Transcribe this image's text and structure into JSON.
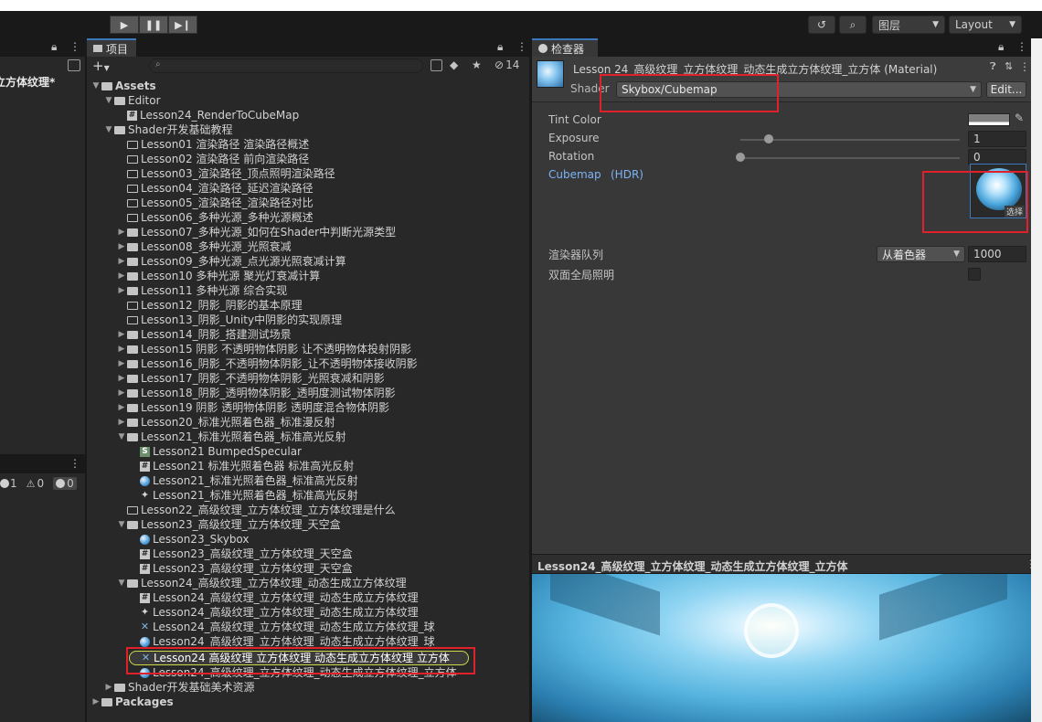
{
  "toolbar": {
    "play_icon": "play-icon",
    "pause_icon": "pause-icon",
    "step_icon": "step-icon",
    "layers_label": "图层",
    "layout_label": "Layout"
  },
  "left_panel": {
    "selected_item": "立方体纹理*",
    "console_counts": {
      "info": "1",
      "warn": "0",
      "error": "0"
    }
  },
  "project": {
    "tab_label": "项目",
    "hidden_count": "14",
    "tree": [
      {
        "depth": 0,
        "arrow": "▼",
        "icon": "folder-open",
        "label": "Assets",
        "bold": true
      },
      {
        "depth": 1,
        "arrow": "▼",
        "icon": "folder-open",
        "label": "Editor"
      },
      {
        "depth": 2,
        "arrow": "",
        "icon": "cs",
        "label": "Lesson24_RenderToCubeMap"
      },
      {
        "depth": 1,
        "arrow": "▼",
        "icon": "folder-open",
        "label": "Shader开发基础教程"
      },
      {
        "depth": 2,
        "arrow": "",
        "icon": "folder-empty",
        "label": "Lesson01 渲染路径 渲染路径概述"
      },
      {
        "depth": 2,
        "arrow": "",
        "icon": "folder-empty",
        "label": "Lesson02 渲染路径 前向渲染路径"
      },
      {
        "depth": 2,
        "arrow": "",
        "icon": "folder-empty",
        "label": "Lesson03_渲染路径_顶点照明渲染路径"
      },
      {
        "depth": 2,
        "arrow": "",
        "icon": "folder-empty",
        "label": "Lesson04_渲染路径_延迟渲染路径"
      },
      {
        "depth": 2,
        "arrow": "",
        "icon": "folder-empty",
        "label": "Lesson05_渲染路径_渲染路径对比"
      },
      {
        "depth": 2,
        "arrow": "",
        "icon": "folder-empty",
        "label": "Lesson06_多种光源_多种光源概述"
      },
      {
        "depth": 2,
        "arrow": "▶",
        "icon": "folder",
        "label": "Lesson07_多种光源_如何在Shader中判断光源类型"
      },
      {
        "depth": 2,
        "arrow": "▶",
        "icon": "folder",
        "label": "Lesson08_多种光源_光照衰减"
      },
      {
        "depth": 2,
        "arrow": "▶",
        "icon": "folder",
        "label": "Lesson09_多种光源_点光源光照衰减计算"
      },
      {
        "depth": 2,
        "arrow": "▶",
        "icon": "folder",
        "label": "Lesson10 多种光源 聚光灯衰减计算"
      },
      {
        "depth": 2,
        "arrow": "▶",
        "icon": "folder",
        "label": "Lesson11 多种光源 综合实现"
      },
      {
        "depth": 2,
        "arrow": "",
        "icon": "folder-empty",
        "label": "Lesson12_阴影_阴影的基本原理"
      },
      {
        "depth": 2,
        "arrow": "",
        "icon": "folder-empty",
        "label": "Lesson13_阴影_Unity中阴影的实现原理"
      },
      {
        "depth": 2,
        "arrow": "▶",
        "icon": "folder",
        "label": "Lesson14_阴影_搭建测试场景"
      },
      {
        "depth": 2,
        "arrow": "▶",
        "icon": "folder",
        "label": "Lesson15 阴影 不透明物体阴影 让不透明物体投射阴影"
      },
      {
        "depth": 2,
        "arrow": "▶",
        "icon": "folder",
        "label": "Lesson16_阴影_不透明物体阴影_让不透明物体接收阴影"
      },
      {
        "depth": 2,
        "arrow": "▶",
        "icon": "folder",
        "label": "Lesson17_阴影_不透明物体阴影_光照衰减和阴影"
      },
      {
        "depth": 2,
        "arrow": "▶",
        "icon": "folder",
        "label": "Lesson18_阴影_透明物体阴影_透明度测试物体阴影"
      },
      {
        "depth": 2,
        "arrow": "▶",
        "icon": "folder",
        "label": "Lesson19 阴影 透明物体阴影 透明度混合物体阴影"
      },
      {
        "depth": 2,
        "arrow": "▶",
        "icon": "folder",
        "label": "Lesson20_标准光照着色器_标准漫反射"
      },
      {
        "depth": 2,
        "arrow": "▼",
        "icon": "folder-open",
        "label": "Lesson21_标准光照着色器_标准高光反射"
      },
      {
        "depth": 3,
        "arrow": "",
        "icon": "shader",
        "label": "Lesson21 BumpedSpecular"
      },
      {
        "depth": 3,
        "arrow": "",
        "icon": "cs",
        "label": "Lesson21 标准光照着色器 标准高光反射"
      },
      {
        "depth": 3,
        "arrow": "",
        "icon": "material",
        "label": "Lesson21_标准光照着色器_标准高光反射"
      },
      {
        "depth": 3,
        "arrow": "",
        "icon": "prefab",
        "label": "Lesson21_标准光照着色器_标准高光反射"
      },
      {
        "depth": 2,
        "arrow": "",
        "icon": "folder-empty",
        "label": "Lesson22_高级纹理_立方体纹理_立方体纹理是什么"
      },
      {
        "depth": 2,
        "arrow": "▼",
        "icon": "folder-open",
        "label": "Lesson23_高级纹理_立方体纹理_天空盒"
      },
      {
        "depth": 3,
        "arrow": "",
        "icon": "material",
        "label": "Lesson23_Skybox"
      },
      {
        "depth": 3,
        "arrow": "",
        "icon": "cs",
        "label": "Lesson23_高级纹理_立方体纹理_天空盒"
      },
      {
        "depth": 3,
        "arrow": "",
        "icon": "cs",
        "label": "Lesson23_高级纹理_立方体纹理_天空盒"
      },
      {
        "depth": 2,
        "arrow": "▼",
        "icon": "folder-open",
        "label": "Lesson24_高级纹理_立方体纹理_动态生成立方体纹理"
      },
      {
        "depth": 3,
        "arrow": "",
        "icon": "cs",
        "label": "Lesson24_高级纹理_立方体纹理_动态生成立方体纹理"
      },
      {
        "depth": 3,
        "arrow": "",
        "icon": "prefab",
        "label": "Lesson24_高级纹理_立方体纹理_动态生成立方体纹理"
      },
      {
        "depth": 3,
        "arrow": "",
        "icon": "rtex",
        "label": "Lesson24_高级纹理_立方体纹理_动态生成立方体纹理_球"
      },
      {
        "depth": 3,
        "arrow": "",
        "icon": "material",
        "label": "Lesson24_高级纹理_立方体纹理_动态生成立方体纹理_球"
      },
      {
        "depth": 3,
        "arrow": "",
        "icon": "rtex",
        "label": "Lesson24 高级纹理 立方体纹理 动态生成立方体纹理 立方体",
        "selected": true
      },
      {
        "depth": 3,
        "arrow": "",
        "icon": "material",
        "label": "Lesson24_高级纹理_立方体纹理_动态生成立方体纹理_立方体"
      },
      {
        "depth": 1,
        "arrow": "▶",
        "icon": "folder",
        "label": "Shader开发基础美术资源"
      },
      {
        "depth": 0,
        "arrow": "▶",
        "icon": "folder",
        "label": "Packages",
        "bold": true
      }
    ]
  },
  "inspector": {
    "tab_label": "检查器",
    "asset_title": "Lesson 24_高级纹理_立方体纹理_动态生成立方体纹理_立方体 (Material)",
    "shader_label": "Shader",
    "shader_value": "Skybox/Cubemap",
    "edit_button": "Edit...",
    "tint_label": "Tint Color",
    "exposure_label": "Exposure",
    "exposure_value": "1",
    "exposure_level": 0.13,
    "rotation_label": "Rotation",
    "rotation_value": "0",
    "rotation_level": 0.0,
    "cubemap_label": "Cubemap",
    "cubemap_hdr": "(HDR)",
    "cubemap_select": "选择",
    "render_queue_label": "渲染器队列",
    "render_queue_mode": "从着色器",
    "render_queue_value": "1000",
    "double_sided_label": "双面全局照明"
  },
  "preview": {
    "title": "Lesson24_高级纹理_立方体纹理_动态生成立方体纹理_立方体"
  },
  "colors": {
    "accent": "#3a79bb",
    "highlight_red": "#e0202a",
    "link_blue": "#7eb3f5"
  }
}
